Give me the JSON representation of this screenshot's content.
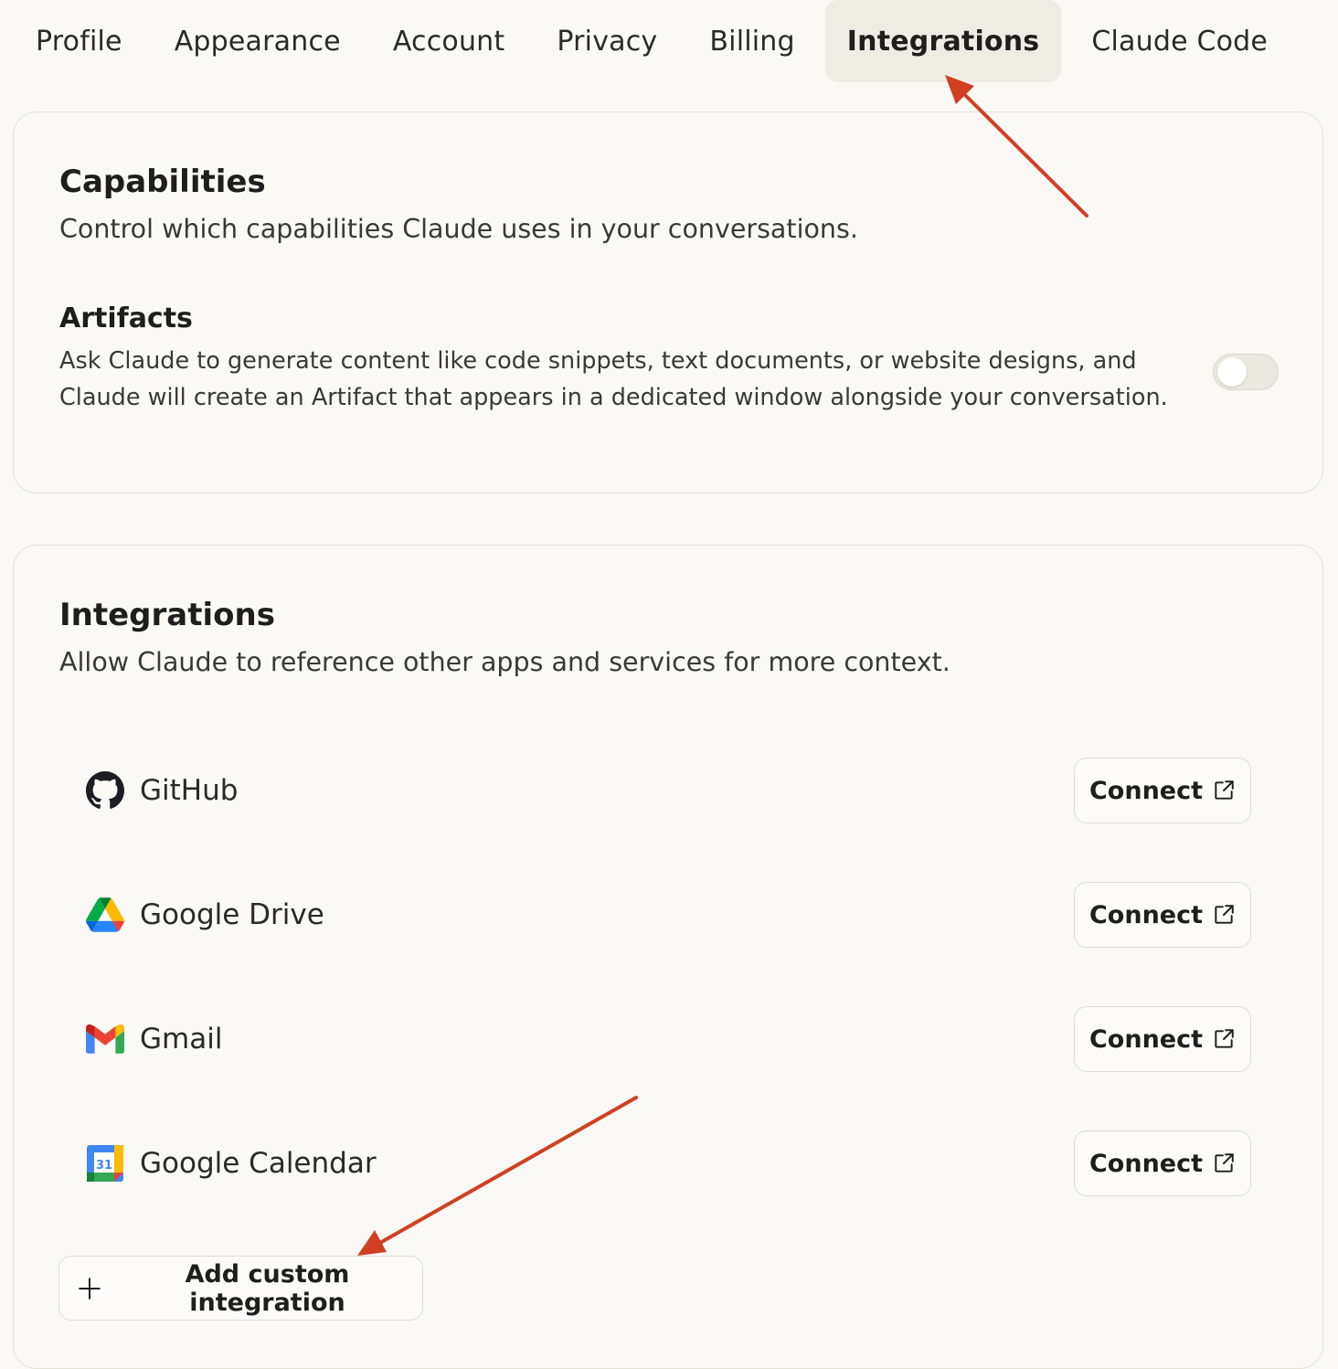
{
  "tabs": [
    {
      "label": "Profile",
      "active": false
    },
    {
      "label": "Appearance",
      "active": false
    },
    {
      "label": "Account",
      "active": false
    },
    {
      "label": "Privacy",
      "active": false
    },
    {
      "label": "Billing",
      "active": false
    },
    {
      "label": "Integrations",
      "active": true
    },
    {
      "label": "Claude Code",
      "active": false
    }
  ],
  "capabilities": {
    "title": "Capabilities",
    "subtitle": "Control which capabilities Claude uses in your conversations.",
    "artifacts": {
      "title": "Artifacts",
      "description": "Ask Claude to generate content like code snippets, text documents, or website designs, and Claude will create an Artifact that appears in a dedicated window alongside your conversation.",
      "enabled": false
    }
  },
  "integrations": {
    "title": "Integrations",
    "subtitle": "Allow Claude to reference other apps and services for more context.",
    "items": [
      {
        "name": "GitHub",
        "icon": "github-icon",
        "action": "Connect"
      },
      {
        "name": "Google Drive",
        "icon": "google-drive-icon",
        "action": "Connect"
      },
      {
        "name": "Gmail",
        "icon": "gmail-icon",
        "action": "Connect"
      },
      {
        "name": "Google Calendar",
        "icon": "google-calendar-icon",
        "action": "Connect"
      }
    ],
    "calendar_icon_day": "31",
    "add_label": "Add custom integration"
  },
  "colors": {
    "background": "#faf9f5",
    "active_tab": "#efece4",
    "annotation_arrow": "#d13f22"
  }
}
